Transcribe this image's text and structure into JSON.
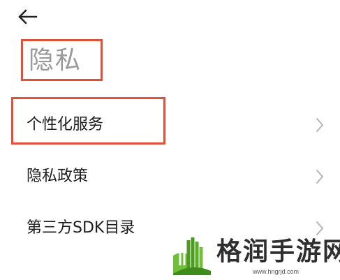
{
  "header": {
    "back_icon": "arrow-left-icon",
    "title": "隐私"
  },
  "menu": {
    "items": [
      {
        "label": "个性化服务",
        "icon": "chevron-right-icon"
      },
      {
        "label": "隐私政策",
        "icon": "chevron-right-icon"
      },
      {
        "label": "第三方SDK目录",
        "icon": "chevron-right-icon"
      }
    ]
  },
  "annotations": {
    "highlight_color": "#e0503a"
  },
  "watermark": {
    "text": "格润手游网",
    "url": "www.hngrjd.com"
  }
}
